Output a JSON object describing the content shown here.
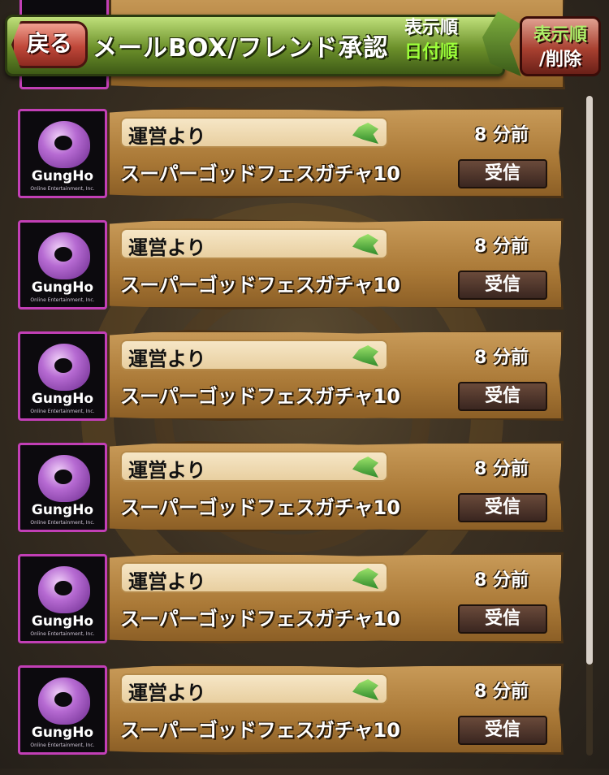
{
  "header": {
    "back_label": "戻る",
    "title": "メールBOX/フレンド承認",
    "sort_label": "表示順",
    "sort_value": "日付順",
    "sort_delete_line1": "表示順",
    "sort_delete_line2": "/削除"
  },
  "mail_items": [
    {
      "sender": "運営より",
      "time": "8 分前",
      "subject": "スーパーゴッドフェスガチャ10",
      "action": "受信",
      "logo": "GungHo",
      "logo_sub": "Online Entertainment, Inc."
    },
    {
      "sender": "運営より",
      "time": "8 分前",
      "subject": "スーパーゴッドフェスガチャ10",
      "action": "受信",
      "logo": "GungHo",
      "logo_sub": "Online Entertainment, Inc."
    },
    {
      "sender": "運営より",
      "time": "8 分前",
      "subject": "スーパーゴッドフェスガチャ10",
      "action": "受信",
      "logo": "GungHo",
      "logo_sub": "Online Entertainment, Inc."
    },
    {
      "sender": "運営より",
      "time": "8 分前",
      "subject": "スーパーゴッドフェスガチャ10",
      "action": "受信",
      "logo": "GungHo",
      "logo_sub": "Online Entertainment, Inc."
    },
    {
      "sender": "運営より",
      "time": "8 分前",
      "subject": "スーパーゴッドフェスガチャ10",
      "action": "受信",
      "logo": "GungHo",
      "logo_sub": "Online Entertainment, Inc."
    },
    {
      "sender": "運営より",
      "time": "8 分前",
      "subject": "スーパーゴッドフェスガチャ10",
      "action": "受信",
      "logo": "GungHo",
      "logo_sub": "Online Entertainment, Inc."
    }
  ],
  "colors": {
    "header_green": "#6b8f2a",
    "back_red": "#c0483a",
    "icon_border": "#c23fb6",
    "panel_brown": "#a97836",
    "sort_value_green": "#9cff3a"
  },
  "icons": {
    "sender_badge": "dragon-icon",
    "logo": "gungho-logo-icon"
  }
}
